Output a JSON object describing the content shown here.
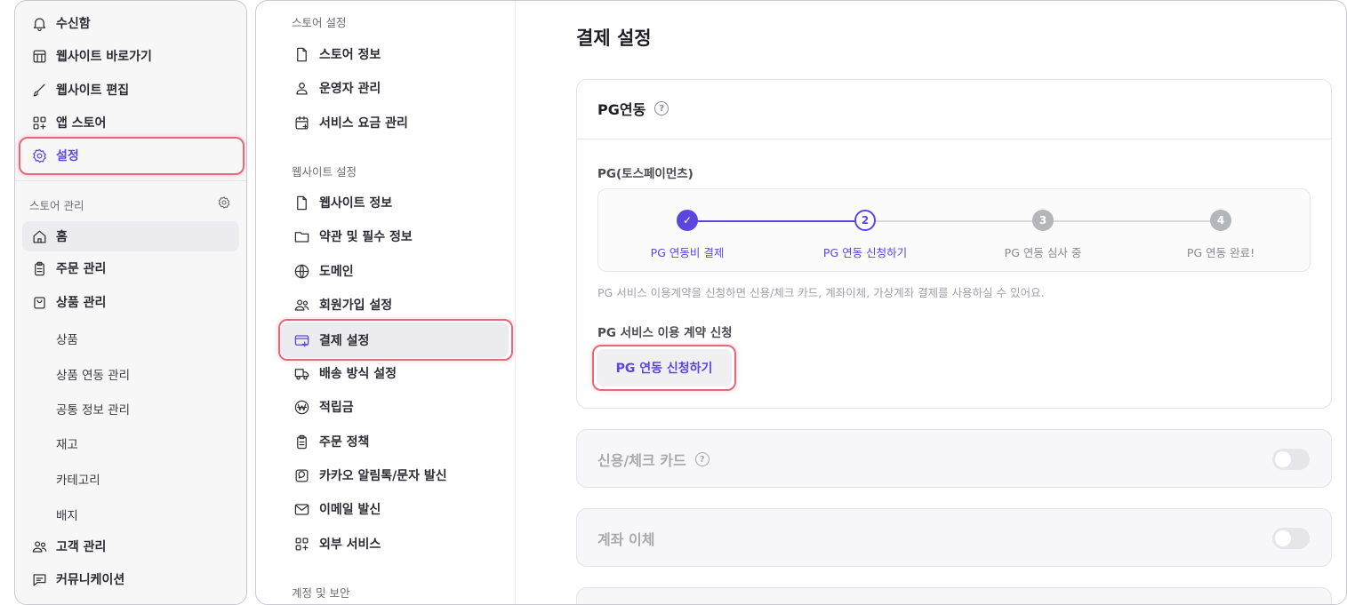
{
  "left_nav": {
    "top_items": [
      {
        "label": "수신함",
        "icon": "bell-icon"
      },
      {
        "label": "웹사이트 바로가기",
        "icon": "store-icon"
      },
      {
        "label": "웹사이트 편집",
        "icon": "brush-icon"
      },
      {
        "label": "앱 스토어",
        "icon": "apps-plus-icon"
      },
      {
        "label": "설정",
        "icon": "gear-icon"
      }
    ],
    "store_section_label": "스토어 관리",
    "store_items": [
      {
        "label": "홈",
        "icon": "home-icon"
      },
      {
        "label": "주문 관리",
        "icon": "clipboard-icon"
      },
      {
        "label": "상품 관리",
        "icon": "bag-icon"
      }
    ],
    "product_sub_items": [
      "상품",
      "상품 연동 관리",
      "공통 정보 관리",
      "재고",
      "카테고리",
      "배지"
    ],
    "bottom_items": [
      {
        "label": "고객 관리",
        "icon": "users-icon"
      },
      {
        "label": "커뮤니케이션",
        "icon": "chat-icon"
      }
    ]
  },
  "settings_menu": {
    "store_section": "스토어 설정",
    "store_items": [
      {
        "label": "스토어 정보",
        "icon": "document-icon"
      },
      {
        "label": "운영자 관리",
        "icon": "person-icon"
      },
      {
        "label": "서비스 요금 관리",
        "icon": "calendar-plus-icon"
      }
    ],
    "website_section": "웹사이트 설정",
    "website_items": [
      {
        "label": "웹사이트 정보",
        "icon": "document-icon"
      },
      {
        "label": "약관 및 필수 정보",
        "icon": "folder-icon"
      },
      {
        "label": "도메인",
        "icon": "globe-icon"
      },
      {
        "label": "회원가입 설정",
        "icon": "users-icon"
      },
      {
        "label": "결제 설정",
        "icon": "card-icon"
      },
      {
        "label": "배송 방식 설정",
        "icon": "truck-icon"
      },
      {
        "label": "적립금",
        "icon": "won-icon"
      },
      {
        "label": "주문 정책",
        "icon": "clipboard-icon"
      },
      {
        "label": "카카오 알림톡/문자 발신",
        "icon": "message-icon"
      },
      {
        "label": "이메일 발신",
        "icon": "mail-icon"
      },
      {
        "label": "외부 서비스",
        "icon": "apps-plus-icon"
      }
    ],
    "account_section": "계정 및 보안"
  },
  "content": {
    "title": "결제 설정",
    "pg_card": {
      "title": "PG연동",
      "help": "?",
      "provider_label": "PG(토스페이먼츠)",
      "steps": [
        {
          "num": "✓",
          "label": "PG 연동비 결제",
          "state": "done"
        },
        {
          "num": "2",
          "label": "PG 연동 신청하기",
          "state": "current"
        },
        {
          "num": "3",
          "label": "PG 연동 심사 중",
          "state": "pending"
        },
        {
          "num": "4",
          "label": "PG 연동 완료!",
          "state": "pending"
        }
      ],
      "description": "PG 서비스 이용계약을 신청하면 신용/체크 카드, 계좌이체, 가상계좌 결제를 사용하실 수 있어요.",
      "contract_label": "PG 서비스 이용 계약 신청",
      "apply_button": "PG 연동 신청하기"
    },
    "card_section": {
      "title": "신용/체크 카드",
      "help": "?"
    },
    "transfer_section": {
      "title": "계좌 이체"
    }
  },
  "colors": {
    "accent": "#5b47e0",
    "highlight": "#e36a7a",
    "step_inactive": "#b5b5bc"
  }
}
